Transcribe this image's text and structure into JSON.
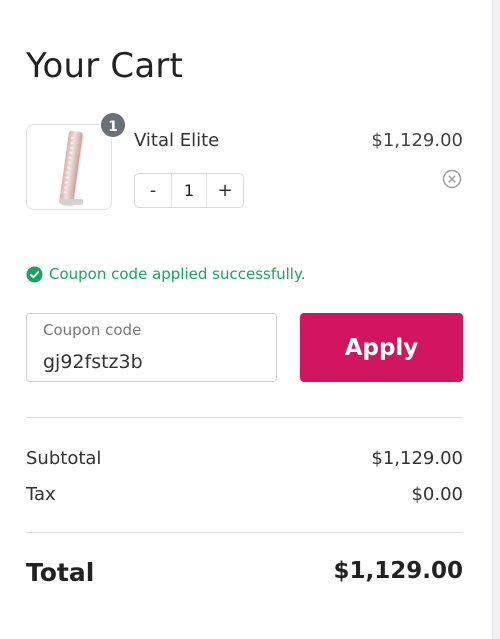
{
  "cart": {
    "title": "Your Cart",
    "items": [
      {
        "name": "Vital Elite",
        "price": "$1,129.00",
        "quantity": "1",
        "quantity_badge": "1",
        "decrement_label": "-",
        "increment_label": "+",
        "image_icon": "product-thumbnail",
        "remove_icon": "close-circle-icon"
      }
    ]
  },
  "coupon": {
    "message": "Coupon code applied successfully.",
    "message_icon": "check-circle-icon",
    "label": "Coupon code",
    "value": "gj92fstz3b",
    "apply_label": "Apply"
  },
  "summary": {
    "subtotal_label": "Subtotal",
    "subtotal_value": "$1,129.00",
    "tax_label": "Tax",
    "tax_value": "$0.00",
    "total_label": "Total",
    "total_value": "$1,129.00"
  },
  "colors": {
    "accent": "#d1155e",
    "success": "#1aa260",
    "badge": "#6b6f76"
  }
}
